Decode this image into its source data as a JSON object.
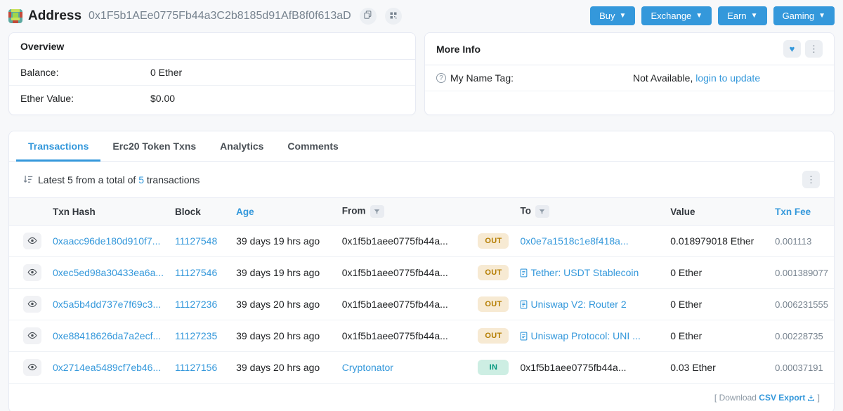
{
  "page": {
    "title_prefix": "Address",
    "address": "0x1F5b1AEe0775Fb44a3C2b8185d91AfB8f0f613aD"
  },
  "nav_buttons": [
    {
      "label": "Buy"
    },
    {
      "label": "Exchange"
    },
    {
      "label": "Earn"
    },
    {
      "label": "Gaming"
    }
  ],
  "overview": {
    "title": "Overview",
    "balance_label": "Balance:",
    "balance_value": "0 Ether",
    "ether_value_label": "Ether Value:",
    "ether_value": "$0.00"
  },
  "more_info": {
    "title": "More Info",
    "name_tag_label": "My Name Tag:",
    "name_tag_value": "Not Available,",
    "name_tag_link": "login to update"
  },
  "tabs": [
    {
      "label": "Transactions",
      "active": true
    },
    {
      "label": "Erc20 Token Txns",
      "active": false
    },
    {
      "label": "Analytics",
      "active": false
    },
    {
      "label": "Comments",
      "active": false
    }
  ],
  "transactions": {
    "summary_prefix": "Latest 5 from a total of",
    "summary_count": "5",
    "summary_suffix": "transactions",
    "columns": {
      "txn_hash": "Txn Hash",
      "block": "Block",
      "age": "Age",
      "from": "From",
      "to": "To",
      "value": "Value",
      "txn_fee": "Txn Fee"
    },
    "rows": [
      {
        "txn_hash": "0xaacc96de180d910f7...",
        "block": "11127548",
        "age": "39 days 19 hrs ago",
        "from": "0x1f5b1aee0775fb44a...",
        "from_is_link": false,
        "direction": "OUT",
        "to": "0x0e7a1518c1e8f418a...",
        "to_is_link": true,
        "to_is_contract": false,
        "value": "0.018979018 Ether",
        "txn_fee": "0.001113"
      },
      {
        "txn_hash": "0xec5ed98a30433ea6a...",
        "block": "11127546",
        "age": "39 days 19 hrs ago",
        "from": "0x1f5b1aee0775fb44a...",
        "from_is_link": false,
        "direction": "OUT",
        "to": "Tether: USDT Stablecoin",
        "to_is_link": true,
        "to_is_contract": true,
        "value": "0 Ether",
        "txn_fee": "0.001389077"
      },
      {
        "txn_hash": "0x5a5b4dd737e7f69c3...",
        "block": "11127236",
        "age": "39 days 20 hrs ago",
        "from": "0x1f5b1aee0775fb44a...",
        "from_is_link": false,
        "direction": "OUT",
        "to": "Uniswap V2: Router 2",
        "to_is_link": true,
        "to_is_contract": true,
        "value": "0 Ether",
        "txn_fee": "0.006231555"
      },
      {
        "txn_hash": "0xe88418626da7a2ecf...",
        "block": "11127235",
        "age": "39 days 20 hrs ago",
        "from": "0x1f5b1aee0775fb44a...",
        "from_is_link": false,
        "direction": "OUT",
        "to": "Uniswap Protocol: UNI ...",
        "to_is_link": true,
        "to_is_contract": true,
        "value": "0 Ether",
        "txn_fee": "0.00228735"
      },
      {
        "txn_hash": "0x2714ea5489cf7eb46...",
        "block": "11127156",
        "age": "39 days 20 hrs ago",
        "from": "Cryptonator",
        "from_is_link": true,
        "direction": "IN",
        "to": "0x1f5b1aee0775fb44a...",
        "to_is_link": false,
        "to_is_contract": false,
        "value": "0.03 Ether",
        "txn_fee": "0.00037191"
      }
    ],
    "footer": {
      "bracket_open": "[",
      "download_label": "Download",
      "csv_label": "CSV Export",
      "bracket_close": "]"
    }
  },
  "colors": {
    "accent_blue": "#3498db",
    "out_badge_bg": "#f7ead3",
    "out_badge_text": "#b47d00",
    "in_badge_bg": "#cdeee3",
    "in_badge_text": "#02977e"
  }
}
